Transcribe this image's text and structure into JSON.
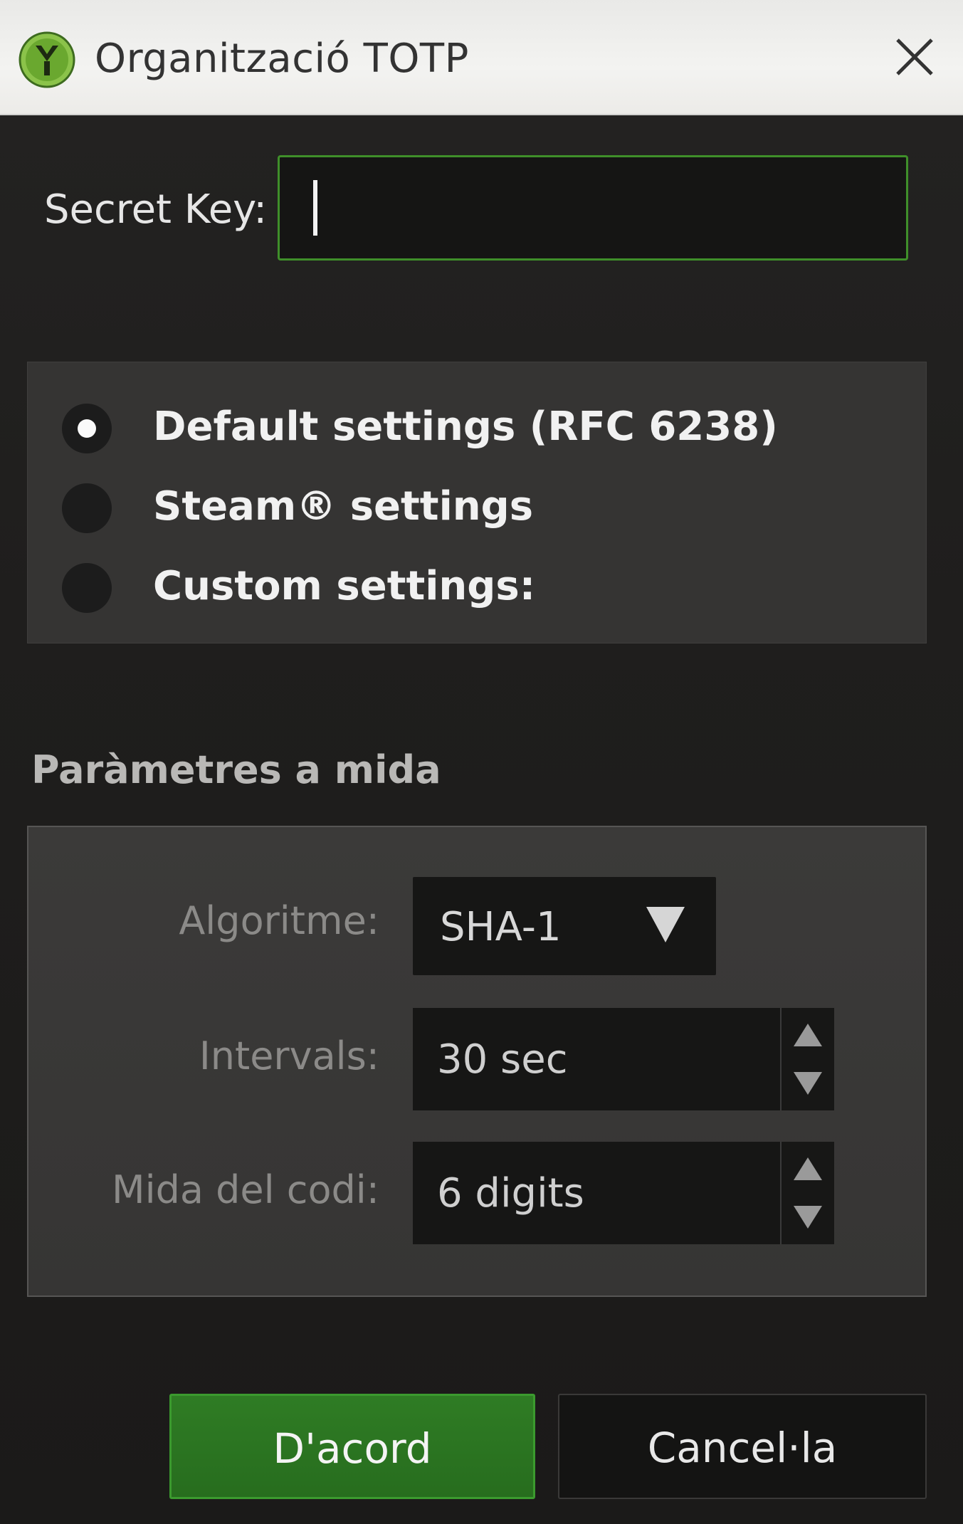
{
  "window": {
    "title": "Organització TOTP",
    "icon": "yubico-logo-icon",
    "close_icon": "close-icon"
  },
  "secret_key": {
    "label": "Secret Key:",
    "value": ""
  },
  "settings_mode": {
    "options": [
      {
        "label": "Default settings (RFC 6238)",
        "checked": true
      },
      {
        "label": "Steam® settings",
        "checked": false
      },
      {
        "label": "Custom settings:",
        "checked": false
      }
    ]
  },
  "custom_params": {
    "title": "Paràmetres a mida",
    "algorithm": {
      "label": "Algoritme:",
      "value": "SHA-1"
    },
    "interval": {
      "label": "Intervals:",
      "value": "30 sec"
    },
    "code_size": {
      "label": "Mida del codi:",
      "value": "6 digits"
    }
  },
  "buttons": {
    "ok": "D'acord",
    "cancel": "Cancel·la"
  },
  "colors": {
    "accent_green": "#3b9a2e",
    "panel": "#353433",
    "background": "#1e1c1b"
  }
}
